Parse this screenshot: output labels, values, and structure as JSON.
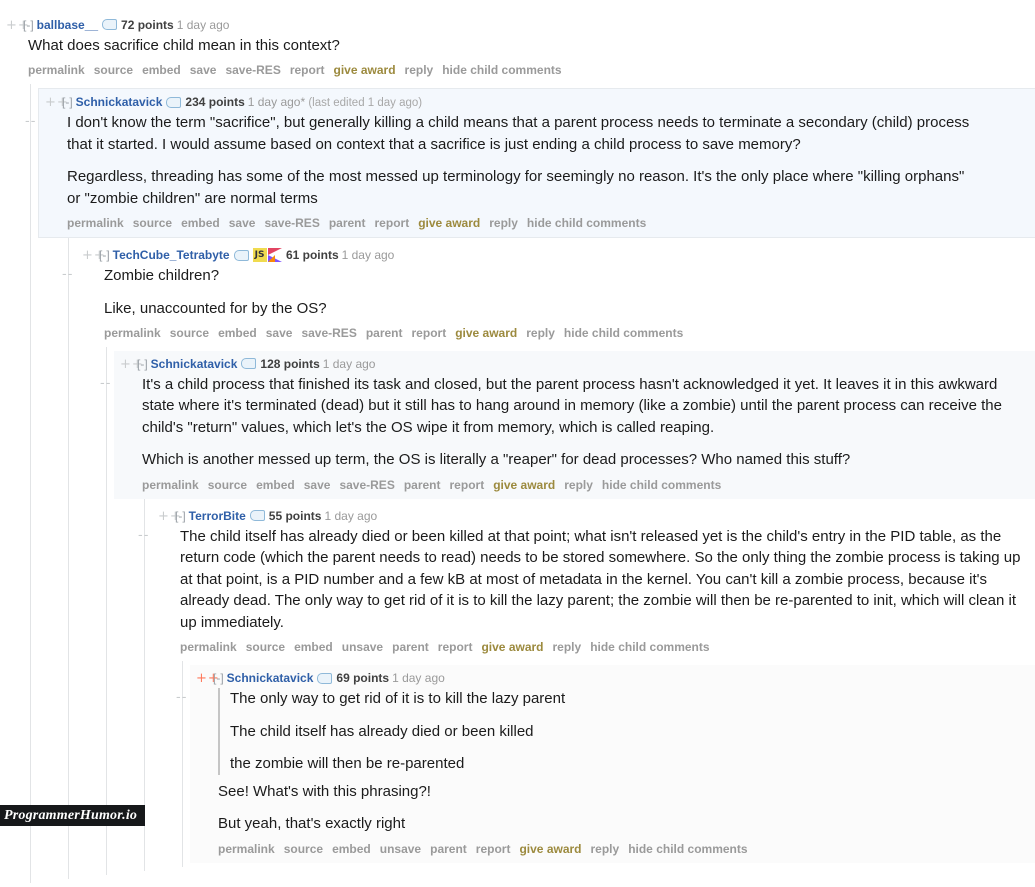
{
  "watermark": {
    "label": "ProgrammerHumor.io"
  },
  "icons": {
    "upvote": "++",
    "downvote": "--",
    "collapse": "[-]",
    "tag_pill": "user-tag-icon",
    "flair_js": "JS",
    "flair_kotlin": "kotlin-icon"
  },
  "comments": [
    {
      "level": 1,
      "author": "ballbase__",
      "score": "72 points",
      "timestamp": "1 day ago",
      "edited": "",
      "voted": false,
      "flair": false,
      "paragraphs": [
        "What does sacrifice child mean in this context?"
      ],
      "quotes": [],
      "actions": [
        "permalink",
        "source",
        "embed",
        "save",
        "save-RES",
        "report",
        "give award",
        "reply",
        "hide child comments"
      ],
      "award_label": "give award"
    },
    {
      "level": 2,
      "author": "Schnickatavick",
      "score": "234 points",
      "timestamp": "1 day ago*",
      "edited": "(last edited 1 day ago)",
      "voted": false,
      "flair": false,
      "paragraphs": [
        "I don't know the term \"sacrifice\", but generally killing a child means that a parent process needs to terminate a secondary (child) process that it started. I would assume based on context that a sacrifice is just ending a child process to save memory?",
        "Regardless, threading has some of the most messed up terminology for seemingly no reason. It's the only place where \"killing orphans\" or \"zombie children\" are normal terms"
      ],
      "quotes": [],
      "actions": [
        "permalink",
        "source",
        "embed",
        "save",
        "save-RES",
        "parent",
        "report",
        "give award",
        "reply",
        "hide child comments"
      ],
      "award_label": "give award"
    },
    {
      "level": 3,
      "author": "TechCube_Tetrabyte",
      "score": "61 points",
      "timestamp": "1 day ago",
      "edited": "",
      "voted": false,
      "flair": true,
      "paragraphs": [
        "Zombie children?",
        "Like, unaccounted for by the OS?"
      ],
      "quotes": [],
      "actions": [
        "permalink",
        "source",
        "embed",
        "save",
        "save-RES",
        "parent",
        "report",
        "give award",
        "reply",
        "hide child comments"
      ],
      "award_label": "give award"
    },
    {
      "level": 4,
      "author": "Schnickatavick",
      "score": "128 points",
      "timestamp": "1 day ago",
      "edited": "",
      "voted": false,
      "flair": false,
      "paragraphs": [
        "It's a child process that finished its task and closed, but the parent process hasn't acknowledged it yet. It leaves it in this awkward state where it's terminated (dead) but it still has to hang around in memory (like a zombie) until the parent process can receive the child's \"return\" values, which let's the OS wipe it from memory, which is called reaping.",
        "Which is another messed up term, the OS is literally a \"reaper\" for dead processes? Who named this stuff?"
      ],
      "quotes": [],
      "actions": [
        "permalink",
        "source",
        "embed",
        "save",
        "save-RES",
        "parent",
        "report",
        "give award",
        "reply",
        "hide child comments"
      ],
      "award_label": "give award"
    },
    {
      "level": 5,
      "author": "TerrorBite",
      "score": "55 points",
      "timestamp": "1 day ago",
      "edited": "",
      "voted": false,
      "flair": false,
      "paragraphs": [
        "The child itself has already died or been killed at that point; what isn't released yet is the child's entry in the PID table, as the return code (which the parent needs to read) needs to be stored somewhere. So the only thing the zombie process is taking up at that point, is a PID number and a few kB at most of metadata in the kernel. You can't kill a zombie process, because it's already dead. The only way to get rid of it is to kill the lazy parent; the zombie will then be re-parented to init, which will clean it up immediately."
      ],
      "quotes": [],
      "actions": [
        "permalink",
        "source",
        "embed",
        "unsave",
        "parent",
        "report",
        "give award",
        "reply",
        "hide child comments"
      ],
      "award_label": "give award"
    },
    {
      "level": 6,
      "author": "Schnickatavick",
      "score": "69 points",
      "timestamp": "1 day ago",
      "edited": "",
      "voted": true,
      "flair": false,
      "quotes": [
        "The only way to get rid of it is to kill the lazy parent",
        "The child itself has already died or been killed",
        "the zombie will then be re-parented"
      ],
      "paragraphs": [
        "See! What's with this phrasing?!",
        "But yeah, that's exactly right"
      ],
      "actions": [
        "permalink",
        "source",
        "embed",
        "unsave",
        "parent",
        "report",
        "give award",
        "reply",
        "hide child comments"
      ],
      "award_label": "give award"
    }
  ]
}
